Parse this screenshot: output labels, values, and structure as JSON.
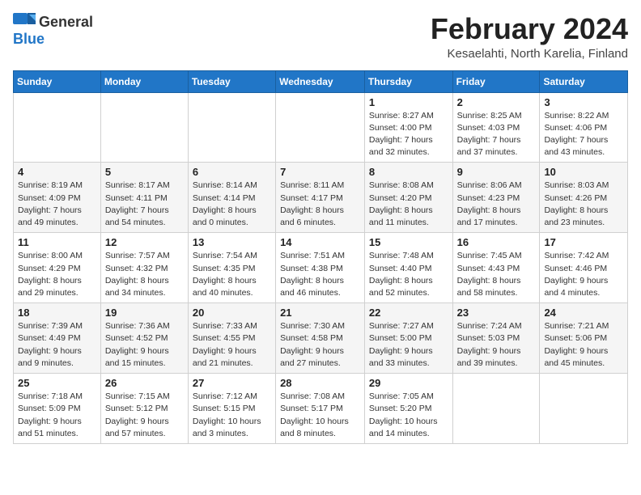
{
  "header": {
    "logo_general": "General",
    "logo_blue": "Blue",
    "title": "February 2024",
    "subtitle": "Kesaelahti, North Karelia, Finland"
  },
  "calendar": {
    "days_of_week": [
      "Sunday",
      "Monday",
      "Tuesday",
      "Wednesday",
      "Thursday",
      "Friday",
      "Saturday"
    ],
    "weeks": [
      [
        {
          "day": "",
          "info": ""
        },
        {
          "day": "",
          "info": ""
        },
        {
          "day": "",
          "info": ""
        },
        {
          "day": "",
          "info": ""
        },
        {
          "day": "1",
          "info": "Sunrise: 8:27 AM\nSunset: 4:00 PM\nDaylight: 7 hours\nand 32 minutes."
        },
        {
          "day": "2",
          "info": "Sunrise: 8:25 AM\nSunset: 4:03 PM\nDaylight: 7 hours\nand 37 minutes."
        },
        {
          "day": "3",
          "info": "Sunrise: 8:22 AM\nSunset: 4:06 PM\nDaylight: 7 hours\nand 43 minutes."
        }
      ],
      [
        {
          "day": "4",
          "info": "Sunrise: 8:19 AM\nSunset: 4:09 PM\nDaylight: 7 hours\nand 49 minutes."
        },
        {
          "day": "5",
          "info": "Sunrise: 8:17 AM\nSunset: 4:11 PM\nDaylight: 7 hours\nand 54 minutes."
        },
        {
          "day": "6",
          "info": "Sunrise: 8:14 AM\nSunset: 4:14 PM\nDaylight: 8 hours\nand 0 minutes."
        },
        {
          "day": "7",
          "info": "Sunrise: 8:11 AM\nSunset: 4:17 PM\nDaylight: 8 hours\nand 6 minutes."
        },
        {
          "day": "8",
          "info": "Sunrise: 8:08 AM\nSunset: 4:20 PM\nDaylight: 8 hours\nand 11 minutes."
        },
        {
          "day": "9",
          "info": "Sunrise: 8:06 AM\nSunset: 4:23 PM\nDaylight: 8 hours\nand 17 minutes."
        },
        {
          "day": "10",
          "info": "Sunrise: 8:03 AM\nSunset: 4:26 PM\nDaylight: 8 hours\nand 23 minutes."
        }
      ],
      [
        {
          "day": "11",
          "info": "Sunrise: 8:00 AM\nSunset: 4:29 PM\nDaylight: 8 hours\nand 29 minutes."
        },
        {
          "day": "12",
          "info": "Sunrise: 7:57 AM\nSunset: 4:32 PM\nDaylight: 8 hours\nand 34 minutes."
        },
        {
          "day": "13",
          "info": "Sunrise: 7:54 AM\nSunset: 4:35 PM\nDaylight: 8 hours\nand 40 minutes."
        },
        {
          "day": "14",
          "info": "Sunrise: 7:51 AM\nSunset: 4:38 PM\nDaylight: 8 hours\nand 46 minutes."
        },
        {
          "day": "15",
          "info": "Sunrise: 7:48 AM\nSunset: 4:40 PM\nDaylight: 8 hours\nand 52 minutes."
        },
        {
          "day": "16",
          "info": "Sunrise: 7:45 AM\nSunset: 4:43 PM\nDaylight: 8 hours\nand 58 minutes."
        },
        {
          "day": "17",
          "info": "Sunrise: 7:42 AM\nSunset: 4:46 PM\nDaylight: 9 hours\nand 4 minutes."
        }
      ],
      [
        {
          "day": "18",
          "info": "Sunrise: 7:39 AM\nSunset: 4:49 PM\nDaylight: 9 hours\nand 9 minutes."
        },
        {
          "day": "19",
          "info": "Sunrise: 7:36 AM\nSunset: 4:52 PM\nDaylight: 9 hours\nand 15 minutes."
        },
        {
          "day": "20",
          "info": "Sunrise: 7:33 AM\nSunset: 4:55 PM\nDaylight: 9 hours\nand 21 minutes."
        },
        {
          "day": "21",
          "info": "Sunrise: 7:30 AM\nSunset: 4:58 PM\nDaylight: 9 hours\nand 27 minutes."
        },
        {
          "day": "22",
          "info": "Sunrise: 7:27 AM\nSunset: 5:00 PM\nDaylight: 9 hours\nand 33 minutes."
        },
        {
          "day": "23",
          "info": "Sunrise: 7:24 AM\nSunset: 5:03 PM\nDaylight: 9 hours\nand 39 minutes."
        },
        {
          "day": "24",
          "info": "Sunrise: 7:21 AM\nSunset: 5:06 PM\nDaylight: 9 hours\nand 45 minutes."
        }
      ],
      [
        {
          "day": "25",
          "info": "Sunrise: 7:18 AM\nSunset: 5:09 PM\nDaylight: 9 hours\nand 51 minutes."
        },
        {
          "day": "26",
          "info": "Sunrise: 7:15 AM\nSunset: 5:12 PM\nDaylight: 9 hours\nand 57 minutes."
        },
        {
          "day": "27",
          "info": "Sunrise: 7:12 AM\nSunset: 5:15 PM\nDaylight: 10 hours\nand 3 minutes."
        },
        {
          "day": "28",
          "info": "Sunrise: 7:08 AM\nSunset: 5:17 PM\nDaylight: 10 hours\nand 8 minutes."
        },
        {
          "day": "29",
          "info": "Sunrise: 7:05 AM\nSunset: 5:20 PM\nDaylight: 10 hours\nand 14 minutes."
        },
        {
          "day": "",
          "info": ""
        },
        {
          "day": "",
          "info": ""
        }
      ]
    ]
  }
}
